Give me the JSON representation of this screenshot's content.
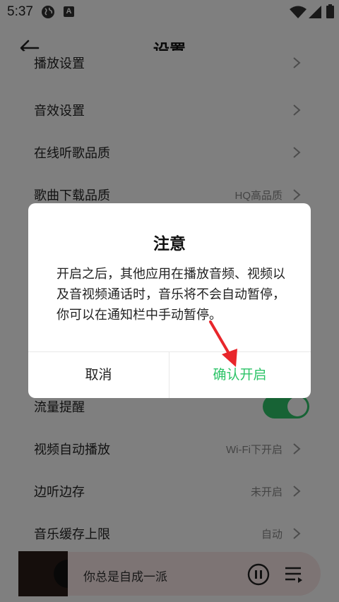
{
  "status_bar": {
    "time": "5:37",
    "icons": [
      "globe-icon",
      "app-a-icon",
      "wifi-icon",
      "signal-icon",
      "battery-icon"
    ],
    "notification_app_letter": "A"
  },
  "header": {
    "title": "设置",
    "back_icon": "back-arrow-icon"
  },
  "settings": {
    "rows": [
      {
        "label": "播放设置",
        "value": "",
        "control": "chevron"
      },
      {
        "label": "音效设置",
        "value": "",
        "control": "chevron"
      },
      {
        "label": "在线听歌品质",
        "value": "",
        "control": "chevron"
      },
      {
        "label": "歌曲下载品质",
        "value": "HQ高品质",
        "control": "chevron"
      },
      {
        "label": "流量提醒",
        "value": "",
        "control": "toggle",
        "toggle_on": true
      },
      {
        "label": "视频自动播放",
        "value": "Wi-Fi下开启",
        "control": "chevron"
      },
      {
        "label": "边听边存",
        "value": "未开启",
        "control": "chevron"
      },
      {
        "label": "音乐缓存上限",
        "value": "自动",
        "control": "chevron"
      }
    ]
  },
  "player": {
    "song": "你总是自成一派",
    "play_icon": "pause-circle-icon",
    "playlist_icon": "playlist-icon"
  },
  "dialog": {
    "title": "注意",
    "message": "开启之后，其他应用在播放音频、视频以及音视频通话时，音乐将不会自动暂停，你可以在通知栏中手动暂停。",
    "cancel_label": "取消",
    "confirm_label": "确认开启"
  },
  "colors": {
    "accent": "#2dc468",
    "annotation": "#e8262b",
    "overlay": "rgba(0,0,0,0.5)"
  }
}
